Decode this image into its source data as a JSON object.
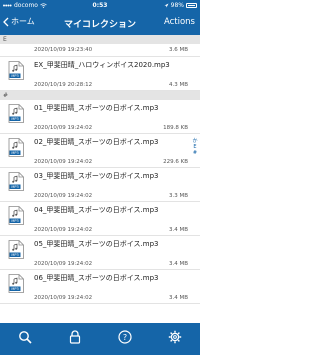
{
  "status_bar": {
    "carrier": "docomo",
    "time": "0:53",
    "battery": "98%"
  },
  "nav": {
    "back_label": "ホーム",
    "title": "マイコレクション",
    "actions_label": "Actions"
  },
  "sections": [
    {
      "header": "E",
      "rows": [
        {
          "name": "",
          "date": "2020/10/09 19:23:40",
          "size": "3.6 MB"
        },
        {
          "name": "EX_甲斐田晴_ハロウィンボイス2020.mp3",
          "date": "2020/10/19 20:28:12",
          "size": "4.3 MB"
        }
      ]
    },
    {
      "header": "#",
      "rows": [
        {
          "name": "01_甲斐田晴_スポーツの日ボイス.mp3",
          "date": "2020/10/09 19:24:02",
          "size": "189.8 KB"
        },
        {
          "name": "02_甲斐田晴_スポーツの日ボイス.mp3",
          "date": "2020/10/09 19:24:02",
          "size": "229.6 KB"
        },
        {
          "name": "03_甲斐田晴_スポーツの日ボイス.mp3",
          "date": "2020/10/09 19:24:02",
          "size": "3.3 MB"
        },
        {
          "name": "04_甲斐田晴_スポーツの日ボイス.mp3",
          "date": "2020/10/09 19:24:02",
          "size": "3.4 MB"
        },
        {
          "name": "05_甲斐田晴_スポーツの日ボイス.mp3",
          "date": "2020/10/09 19:24:02",
          "size": "3.4 MB"
        },
        {
          "name": "06_甲斐田晴_スポーツの日ボイス.mp3",
          "date": "2020/10/09 19:24:02",
          "size": "3.4 MB"
        }
      ]
    }
  ],
  "index_bar": [
    "か",
    "E",
    "#"
  ],
  "file_icon_label": "MP3",
  "tabs": [
    "search-icon",
    "lock-icon",
    "help-icon",
    "gear-icon"
  ],
  "colors": {
    "brand": "#1565a8",
    "section_bg": "#e4e4e4"
  }
}
